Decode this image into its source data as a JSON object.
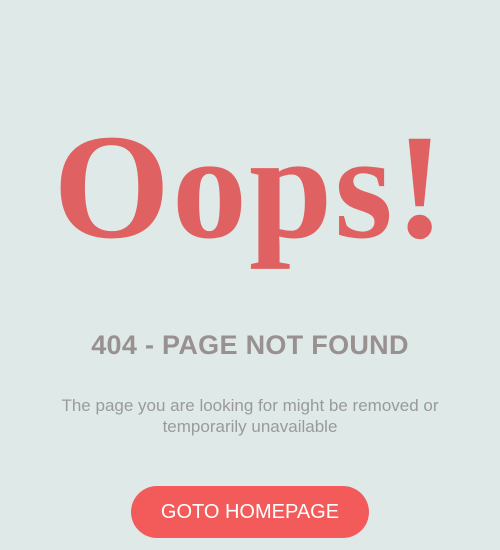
{
  "error": {
    "headline": "Oops!",
    "title": "404 - PAGE NOT FOUND",
    "message": "The page you are looking for might be removed or temporarily unavailable"
  },
  "actions": {
    "home_label": "GOTO HOMEPAGE"
  },
  "colors": {
    "background": "#dfe9e8",
    "headline": "#e06161",
    "title": "#999191",
    "message": "#9a9a9a",
    "button": "#f35b5b",
    "button_text": "#ffffff"
  }
}
